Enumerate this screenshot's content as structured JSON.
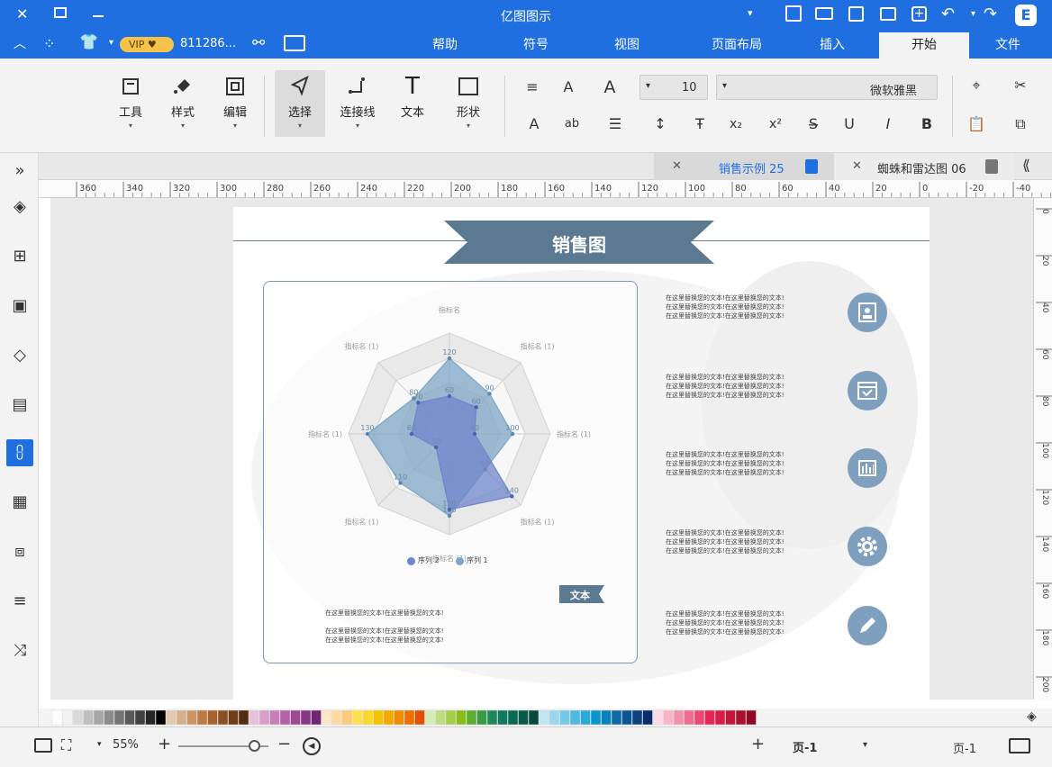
{
  "app": {
    "title": "亿图图示",
    "user_id": "811286...",
    "vip": "VIP"
  },
  "menu": {
    "tabs": [
      "文件",
      "开始",
      "插入",
      "页面布局",
      "视图",
      "符号",
      "帮助"
    ],
    "active": "开始"
  },
  "ribbon": {
    "buttons": [
      "形状",
      "文本",
      "连接线",
      "选择",
      "编辑",
      "样式",
      "工具"
    ],
    "font_name": "微软雅黑",
    "font_size": "10"
  },
  "doc_tabs": [
    {
      "label": "蜘蛛和雷达图 06",
      "active": false
    },
    {
      "label": "销售示例 25",
      "active": true
    }
  ],
  "ruler": {
    "h_ticks": [
      "-40",
      "-20",
      "0",
      "20",
      "40",
      "60",
      "80",
      "100",
      "120",
      "140",
      "160",
      "180",
      "200",
      "220",
      "240",
      "260",
      "280",
      "300",
      "320",
      "340",
      "360"
    ],
    "v_ticks": [
      "0",
      "20",
      "40",
      "60",
      "80",
      "100",
      "120",
      "140",
      "160",
      "180",
      "200"
    ]
  },
  "diagram": {
    "title": "销售图",
    "text_badge": "文本",
    "body_line1": "在这里替换您的文本!在这里替换您的文本!",
    "body_line2": "在这里替换您的文本!在这里替换您的文本!",
    "body_line3": "在这里替换您的文本!在这里替换您的文本!",
    "side_line": "在这里替换您的文本!在这里替换您的文本!",
    "icons": [
      "contact-card-icon",
      "calendar-icon",
      "bar-chart-icon",
      "gear-icon",
      "pencil-icon"
    ]
  },
  "chart_data": {
    "type": "radar",
    "axes": [
      "指标名",
      "指标名 (1)",
      "指标名 (1)",
      "指标名 (1)",
      "指标名 (1)",
      "指标名 (1)",
      "指标名 (1)",
      "指标名 (1)"
    ],
    "rmax": 160,
    "series": [
      {
        "name": "序列 1",
        "color": "#7ea6c4",
        "values": [
          120,
          90,
          100,
          80,
          130,
          110,
          130,
          80
        ]
      },
      {
        "name": "序列 2",
        "color": "#6f86cc",
        "values": [
          60,
          60,
          40,
          140,
          120,
          30,
          60,
          70
        ]
      }
    ],
    "legend": [
      "序列 1",
      "序列 2"
    ]
  },
  "status": {
    "page_label": "页-1",
    "page_tab": "页-1",
    "zoom": "55%"
  },
  "colors": {
    "brand": "#1f6fe0",
    "banner": "#5b7a92",
    "icon_circle": "#7f9fbf"
  }
}
